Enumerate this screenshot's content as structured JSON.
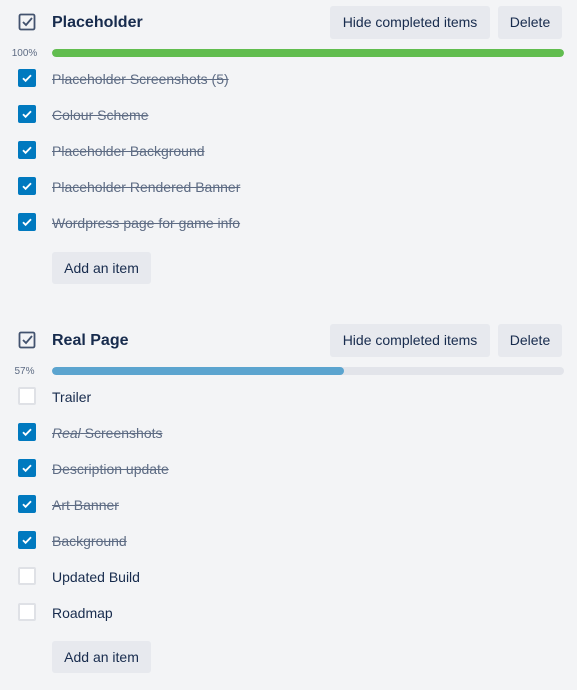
{
  "checklists": [
    {
      "title": "Placeholder",
      "hide_label": "Hide completed items",
      "delete_label": "Delete",
      "percent_label": "100%",
      "progress": 1.0,
      "bar_color": "#61bd4f",
      "add_label": "Add an item",
      "items": [
        {
          "prefix": "",
          "text": "Placeholder Screenshots (5)",
          "checked": true
        },
        {
          "prefix": "",
          "text": "Colour Scheme",
          "checked": true
        },
        {
          "prefix": "",
          "text": "Placeholder Background",
          "checked": true
        },
        {
          "prefix": "",
          "text": "Placeholder Rendered Banner",
          "checked": true
        },
        {
          "prefix": "",
          "text": "Wordpress page for game info",
          "checked": true
        }
      ]
    },
    {
      "title": "Real Page",
      "hide_label": "Hide completed items",
      "delete_label": "Delete",
      "percent_label": "57%",
      "progress": 0.57,
      "bar_color": "#5ba4cf",
      "add_label": "Add an item",
      "items": [
        {
          "prefix": "",
          "text": "Trailer",
          "checked": false
        },
        {
          "prefix": "Real",
          "text": " Screenshots",
          "checked": true
        },
        {
          "prefix": "",
          "text": "Description update",
          "checked": true
        },
        {
          "prefix": "",
          "text": "Art Banner",
          "checked": true
        },
        {
          "prefix": "",
          "text": "Background",
          "checked": true
        },
        {
          "prefix": "",
          "text": "Updated Build",
          "checked": false
        },
        {
          "prefix": "",
          "text": "Roadmap",
          "checked": false
        }
      ]
    }
  ],
  "icons": {
    "header": "checklist-icon",
    "checkmark": "checkmark-icon"
  }
}
